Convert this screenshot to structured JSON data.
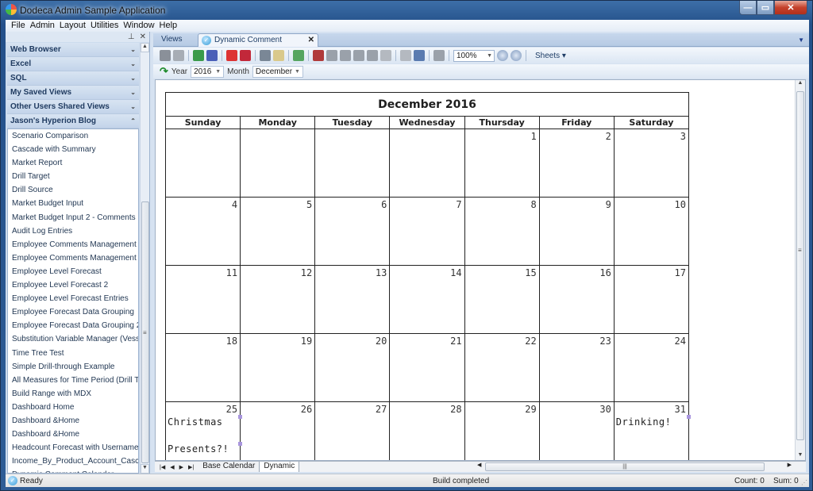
{
  "window": {
    "title": "Dodeca Admin Sample Application"
  },
  "menu": [
    "File",
    "Admin",
    "Layout",
    "Utilities",
    "Window",
    "Help"
  ],
  "sidebar": {
    "groups": [
      {
        "label": "Web Browser",
        "expanded": false
      },
      {
        "label": "Excel",
        "expanded": false
      },
      {
        "label": "SQL",
        "expanded": false
      },
      {
        "label": "My Saved Views",
        "expanded": false
      },
      {
        "label": "Other Users Shared Views",
        "expanded": false
      },
      {
        "label": "Jason's Hyperion Blog",
        "expanded": true
      }
    ],
    "items": [
      "Scenario Comparison",
      "Cascade with Summary",
      "Market Report",
      "Drill Target",
      "Drill Source",
      "Market Budget Input",
      "Market Budget Input 2 - Comments",
      "Audit Log Entries",
      "Employee  Comments  Management  (E...",
      "Employee Comments Management",
      "Employee Level Forecast",
      "Employee Level Forecast 2",
      "Employee Level Forecast Entries",
      "Employee Forecast Data Grouping",
      "Employee Forecast Data Grouping 2",
      "Substitution Variable Manager (Vess)",
      "Time Tree Test",
      "Simple Drill-through Example",
      "All Measures for Time Period (Drill Tar...",
      "Build Range with MDX",
      "Dashboard Home",
      "Dashboard &Home",
      "Dashboard &Home",
      "Headcount Forecast with Username",
      "Income_By_Product_Account_Cascade",
      "Dynamic Comment Calendar"
    ]
  },
  "tabs": {
    "views": "Views",
    "active": "Dynamic Comment Calendar"
  },
  "toolbar": {
    "zoom": "100%",
    "sheets": "Sheets",
    "year_label": "Year",
    "year_value": "2016",
    "month_label": "Month",
    "month_value": "December"
  },
  "calendar": {
    "title": "December 2016",
    "weekdays": [
      "Sunday",
      "Monday",
      "Tuesday",
      "Wednesday",
      "Thursday",
      "Friday",
      "Saturday"
    ],
    "weeks": [
      [
        "",
        "",
        "",
        "",
        "1",
        "2",
        "3"
      ],
      [
        "4",
        "5",
        "6",
        "7",
        "8",
        "9",
        "10"
      ],
      [
        "11",
        "12",
        "13",
        "14",
        "15",
        "16",
        "17"
      ],
      [
        "18",
        "19",
        "20",
        "21",
        "22",
        "23",
        "24"
      ],
      [
        "25",
        "26",
        "27",
        "28",
        "29",
        "30",
        "31"
      ]
    ],
    "notes": {
      "25": [
        "Christmas",
        "Presents?!"
      ],
      "31": [
        "Drinking!"
      ]
    }
  },
  "sheet_tabs": [
    "Base Calendar",
    "Dynamic"
  ],
  "active_sheet": "Dynamic",
  "status": {
    "ready": "Ready",
    "message": "Build completed",
    "count": "Count: 0",
    "sum": "Sum: 0"
  },
  "colors": {
    "comment_marker": "#a996de",
    "title_bar": "#24508a",
    "close_button": "#c4412b"
  }
}
